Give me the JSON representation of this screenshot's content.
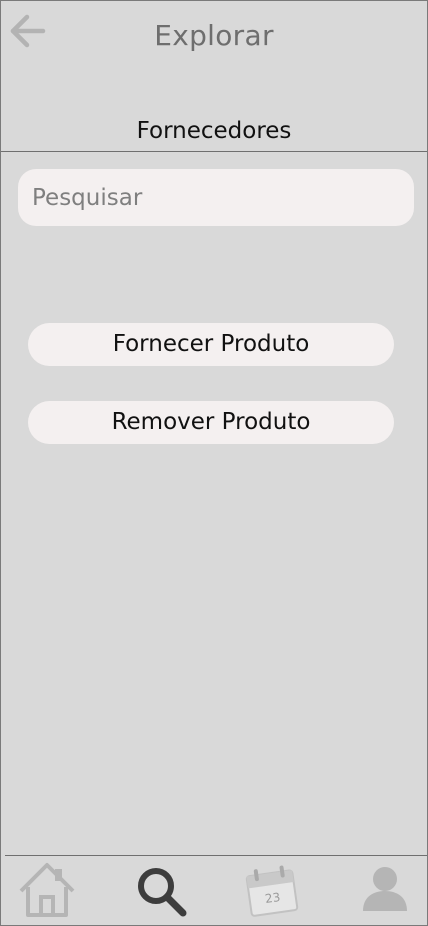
{
  "header": {
    "title": "Explorar",
    "back_icon": "arrow-left-icon"
  },
  "section": {
    "title": "Fornecedores"
  },
  "search": {
    "placeholder": "Pesquisar",
    "value": ""
  },
  "actions": {
    "supply_label": "Fornecer Produto",
    "remove_label": "Remover Produto"
  },
  "bottom_nav": {
    "items": [
      {
        "icon": "home-icon",
        "active": false
      },
      {
        "icon": "search-icon",
        "active": true
      },
      {
        "icon": "calendar-icon",
        "active": false,
        "day": "23"
      },
      {
        "icon": "user-icon",
        "active": false
      }
    ]
  },
  "colors": {
    "background": "#d9d9d9",
    "pill": "#f4f0f0",
    "title_gray": "#6e6e6e",
    "icon_inactive": "#b5b5b5",
    "icon_active": "#3d3d3d"
  }
}
